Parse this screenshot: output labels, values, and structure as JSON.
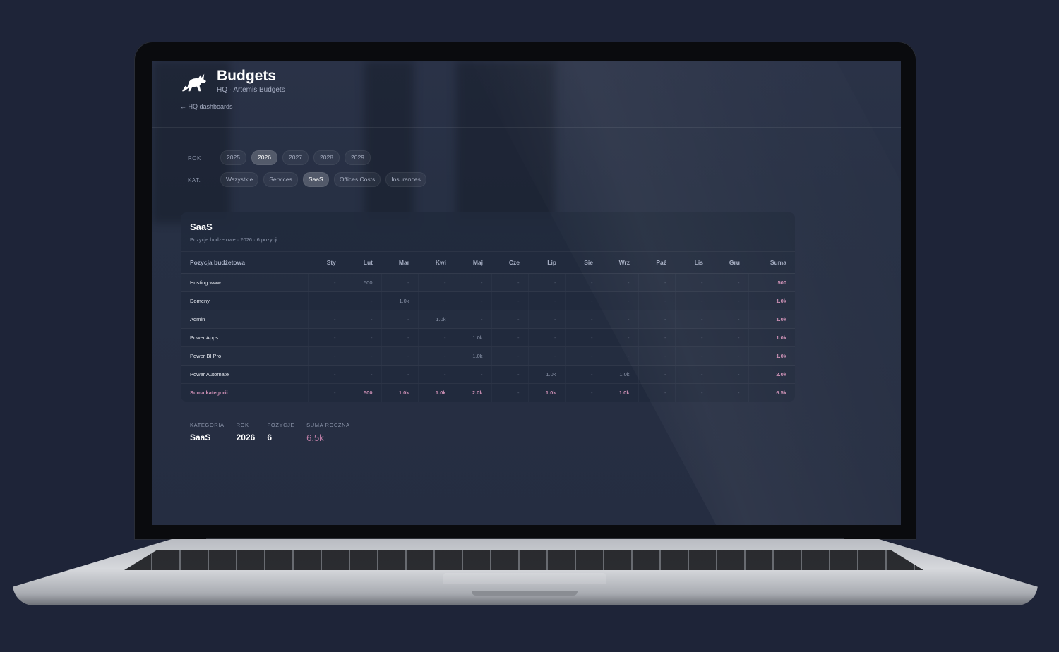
{
  "header": {
    "title": "Budgets",
    "subtitle": "HQ · Artemis Budgets",
    "back_link": "← HQ dashboards"
  },
  "filters": {
    "year_label": "ROK",
    "years": [
      "2025",
      "2026",
      "2027",
      "2028",
      "2029"
    ],
    "selected_year": "2026",
    "category_label": "KAT.",
    "categories": [
      "Wszystkie",
      "Services",
      "SaaS",
      "Offices Costs",
      "Insurances"
    ],
    "selected_category": "SaaS"
  },
  "card": {
    "title": "SaaS",
    "subtitle": "Pozycje budżetowe · 2026 · 6 pozycji",
    "columns": [
      "Pozycja budżetowa",
      "Sty",
      "Lut",
      "Mar",
      "Kwi",
      "Maj",
      "Cze",
      "Lip",
      "Sie",
      "Wrz",
      "Paź",
      "Lis",
      "Gru",
      "Suma"
    ],
    "rows": [
      {
        "name": "Hosting www",
        "values": [
          "-",
          "500",
          "-",
          "-",
          "-",
          "-",
          "-",
          "-",
          "-",
          "-",
          "-",
          "-"
        ],
        "sum": "500"
      },
      {
        "name": "Domeny",
        "values": [
          "-",
          "-",
          "1.0k",
          "-",
          "-",
          "-",
          "-",
          "-",
          "-",
          "-",
          "-",
          "-"
        ],
        "sum": "1.0k"
      },
      {
        "name": "Admin",
        "values": [
          "-",
          "-",
          "-",
          "1.0k",
          "-",
          "-",
          "-",
          "-",
          "-",
          "-",
          "-",
          "-"
        ],
        "sum": "1.0k"
      },
      {
        "name": "Power Apps",
        "values": [
          "-",
          "-",
          "-",
          "-",
          "1.0k",
          "-",
          "-",
          "-",
          "-",
          "-",
          "-",
          "-"
        ],
        "sum": "1.0k"
      },
      {
        "name": "Power BI Pro",
        "values": [
          "-",
          "-",
          "-",
          "-",
          "1.0k",
          "-",
          "-",
          "-",
          "-",
          "-",
          "-",
          "-"
        ],
        "sum": "1.0k"
      },
      {
        "name": "Power Automate",
        "values": [
          "-",
          "-",
          "-",
          "-",
          "-",
          "-",
          "1.0k",
          "-",
          "1.0k",
          "-",
          "-",
          "-"
        ],
        "sum": "2.0k"
      }
    ],
    "total": {
      "name": "Suma kategorii",
      "values": [
        "-",
        "500",
        "1.0k",
        "1.0k",
        "2.0k",
        "-",
        "1.0k",
        "-",
        "1.0k",
        "-",
        "-",
        "-"
      ],
      "sum": "6.5k"
    }
  },
  "stats": [
    {
      "label": "KATEGORIA",
      "value": "SaaS"
    },
    {
      "label": "ROK",
      "value": "2026"
    },
    {
      "label": "POZYCJE",
      "value": "6"
    },
    {
      "label": "SUMA ROCZNA",
      "value": "6.5k"
    }
  ],
  "colors": {
    "background": "#1e2438",
    "accent": "#c98db2",
    "panel": "#212a3c"
  }
}
